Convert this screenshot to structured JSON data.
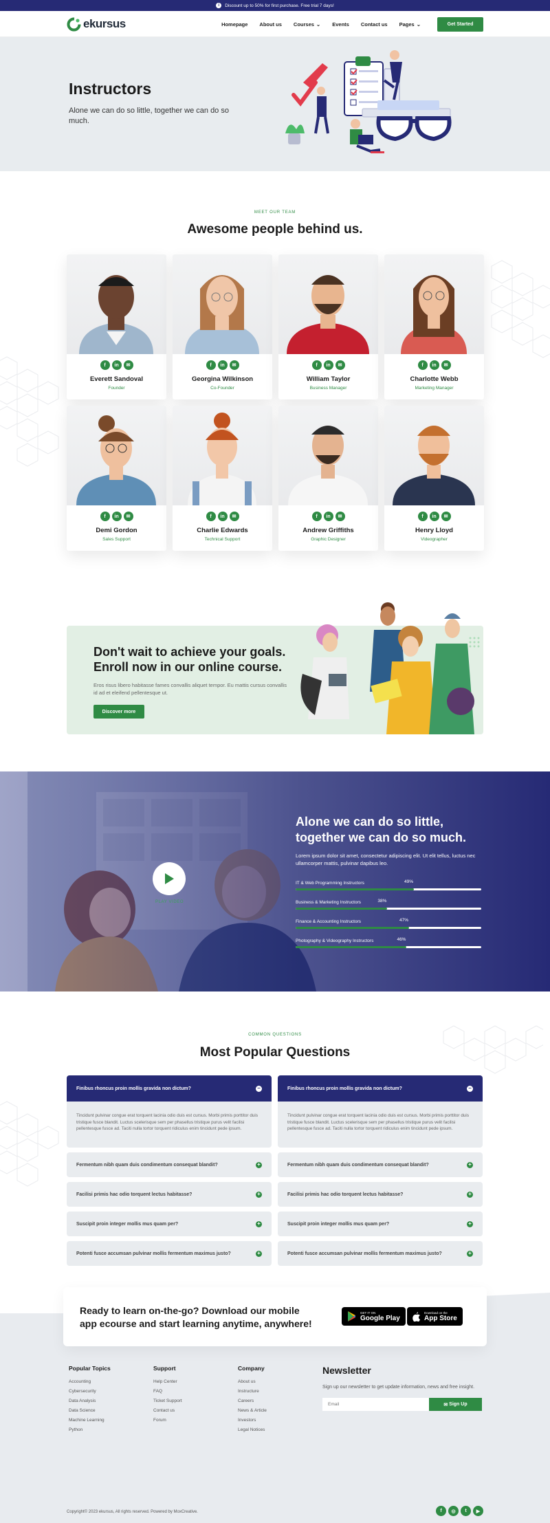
{
  "topbar": {
    "info_icon": "i",
    "text": "Discount up to 50% for first purchase. Free trial 7 days!"
  },
  "header": {
    "logo": "ekursus",
    "nav": [
      "Homepage",
      "About us",
      "Courses",
      "Events",
      "Contact us",
      "Pages"
    ],
    "cta": "Get Started"
  },
  "hero": {
    "title": "Instructors",
    "subtitle": "Alone we can do so little, together we can do so much."
  },
  "team": {
    "eyebrow": "MEET OUR TEAM",
    "title": "Awesome people behind us.",
    "members": [
      {
        "name": "Everett Sandoval",
        "role": "Founder"
      },
      {
        "name": "Georgina Wilkinson",
        "role": "Co-Founder"
      },
      {
        "name": "William Taylor",
        "role": "Business Manager"
      },
      {
        "name": "Charlotte Webb",
        "role": "Marketing Manager"
      },
      {
        "name": "Demi Gordon",
        "role": "Sales Support"
      },
      {
        "name": "Charlie Edwards",
        "role": "Technical Support"
      },
      {
        "name": "Andrew Griffiths",
        "role": "Graphic Designer"
      },
      {
        "name": "Henry Lloyd",
        "role": "Videographer"
      }
    ],
    "social_icons": [
      "facebook-icon",
      "linkedin-icon",
      "email-icon"
    ]
  },
  "enroll": {
    "title": "Don't wait to achieve your goals. Enroll now in our online course.",
    "text": "Eros risus libero habitasse fames convallis aliquet tempor. Eu mattis cursus convallis id ad et eleifend pellentesque ut.",
    "button": "Discover more"
  },
  "skills": {
    "play_label": "PLAY VIDEO",
    "title": "Alone we can do so little, together we can do so much.",
    "text": "Lorem ipsum dolor sit amet, consectetur adipiscing elit. Ut elit tellus, luctus nec ullamcorper mattis, pulvinar dapibus leo.",
    "bars": [
      {
        "label": "IT & Web Programming Instructors",
        "percent": 49,
        "percent_label": "49%"
      },
      {
        "label": "Business & Marketing Instructors",
        "percent": 38,
        "percent_label": "38%"
      },
      {
        "label": "Finance & Accounting Instructors",
        "percent": 47,
        "percent_label": "47%"
      },
      {
        "label": "Photography & Videography Instructors",
        "percent": 46,
        "percent_label": "46%"
      }
    ]
  },
  "faq": {
    "eyebrow": "COMMON QUESTIONS",
    "title": "Most Popular Questions",
    "open_question": "Finibus rhoncus proin mollis gravida non dictum?",
    "open_answer": "Tincidunt pulvinar congue erat torquent lacinia odio duis est cursus. Morbi primis porttitor duis tristique fusce blandit. Luctus scelerisque sem per phasellus tristique purus velit facilisi pellentesque fusce ad. Taciti nulla tortor torquent ridiculus enim tincidunt pede ipsum.",
    "questions": [
      "Fermentum nibh quam duis condimentum consequat blandit?",
      "Facilisi primis hac odio torquent lectus habitasse?",
      "Suscipit proin integer mollis mus quam per?",
      "Potenti fusce accumsan pulvinar mollis fermentum maximus justo?"
    ]
  },
  "app": {
    "title": "Ready to learn on-the-go? Download our mobile app ecourse and start learning anytime, anywhere!",
    "google_small": "GET IT ON",
    "google_big": "Google Play",
    "apple_small": "Download on the",
    "apple_big": "App Store"
  },
  "footer": {
    "columns": [
      {
        "title": "Popular Topics",
        "links": [
          "Accounting",
          "Cybersecurity",
          "Data Analysis",
          "Data Science",
          "Machine Learning",
          "Python"
        ]
      },
      {
        "title": "Support",
        "links": [
          "Help Center",
          "FAQ",
          "Ticket Support",
          "Contact us",
          "Forum"
        ]
      },
      {
        "title": "Company",
        "links": [
          "About us",
          "Instructure",
          "Careers",
          "News & Article",
          "Investors",
          "Legal Notices"
        ]
      }
    ],
    "newsletter_title": "Newsletter",
    "newsletter_text": "Sign up our newsletter to get update information, news and free insight.",
    "email_placeholder": "Email",
    "signup": "Sign Up",
    "copyright": "Copyright© 2023 ekursus, All rights reserved. Powered by MoxCreative.",
    "social_icons": [
      "facebook-icon",
      "instagram-icon",
      "twitter-icon",
      "youtube-icon"
    ]
  },
  "colors": {
    "primary": "#2f8b44",
    "navy": "#262a75",
    "light": "#e8ecef"
  }
}
